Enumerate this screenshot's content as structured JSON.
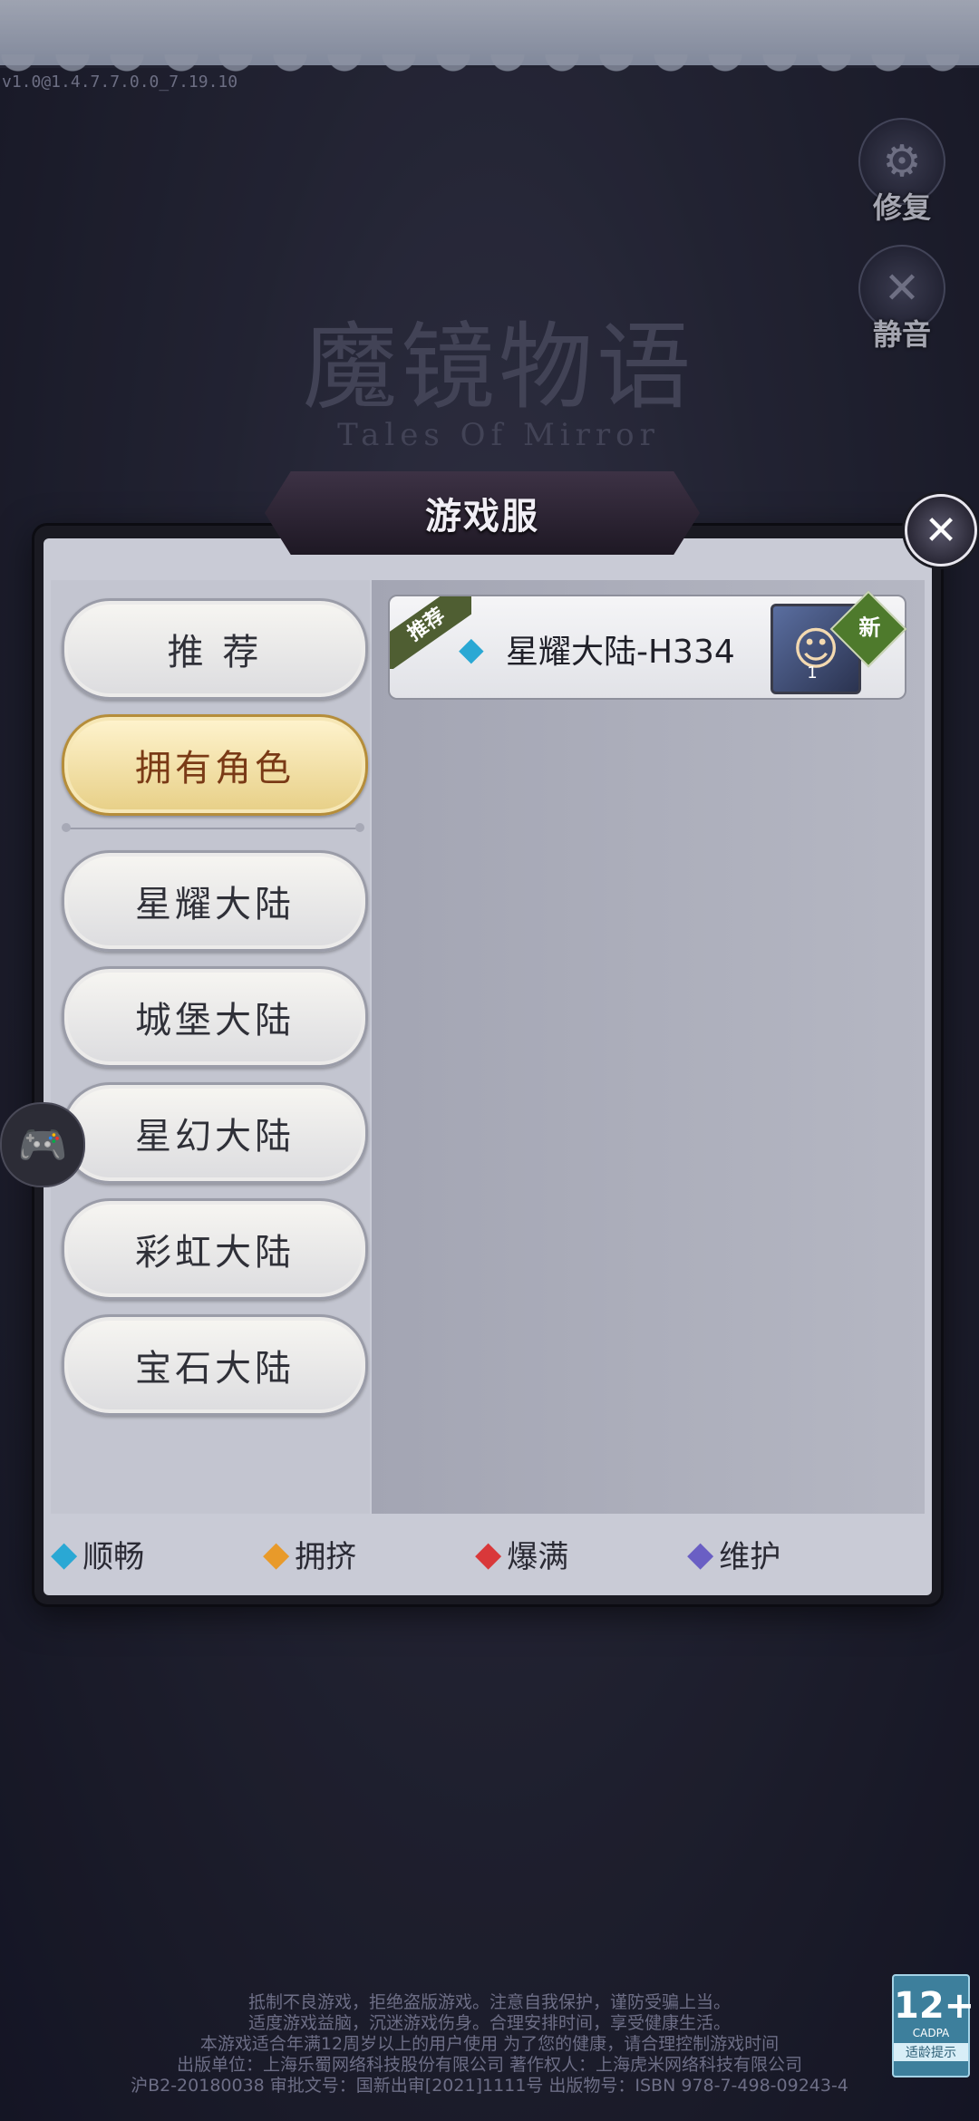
{
  "version": "v1.0@1.4.7.7.0.0_7.19.10",
  "side_buttons": {
    "repair_label": "修复",
    "mute_label": "静音"
  },
  "logo": {
    "title": "魔镜物语",
    "subtitle": "Tales Of Mirror"
  },
  "dialog": {
    "title": "游戏服",
    "close_icon": "close-icon"
  },
  "categories": [
    {
      "label": "推  荐",
      "active": false
    },
    {
      "label": "拥有角色",
      "active": true
    },
    {
      "label": "星耀大陆",
      "active": false
    },
    {
      "label": "城堡大陆",
      "active": false
    },
    {
      "label": "星幻大陆",
      "active": false
    },
    {
      "label": "彩虹大陆",
      "active": false
    },
    {
      "label": "宝石大陆",
      "active": false
    }
  ],
  "servers": [
    {
      "ribbon": "推荐",
      "name": "星耀大陆-H334",
      "status_color": "#2aa8d4",
      "avatar_level": "1",
      "badge": "新"
    }
  ],
  "legend": [
    {
      "label": "顺畅",
      "color": "#2aa8d4"
    },
    {
      "label": "拥挤",
      "color": "#e89a2a"
    },
    {
      "label": "爆满",
      "color": "#d9383a"
    },
    {
      "label": "维护",
      "color": "#6a5fc4"
    }
  ],
  "notice": {
    "line1": "抵制不良游戏，拒绝盗版游戏。注意自我保护，谨防受骗上当。",
    "line2": "适度游戏益脑，沉迷游戏伤身。合理安排时间，享受健康生活。",
    "line3": "本游戏适合年满12周岁以上的用户使用 为了您的健康，请合理控制游戏时间",
    "line4": "出版单位：上海乐蜀网络科技股份有限公司 著作权人：上海虎米网络科技有限公司",
    "line5": "沪B2-20180038 审批文号：国新出审[2021]1111号 出版物号：ISBN 978-7-498-09243-4"
  },
  "age_badge": {
    "age": "12+",
    "org": "CADPA",
    "tip": "适龄提示"
  }
}
